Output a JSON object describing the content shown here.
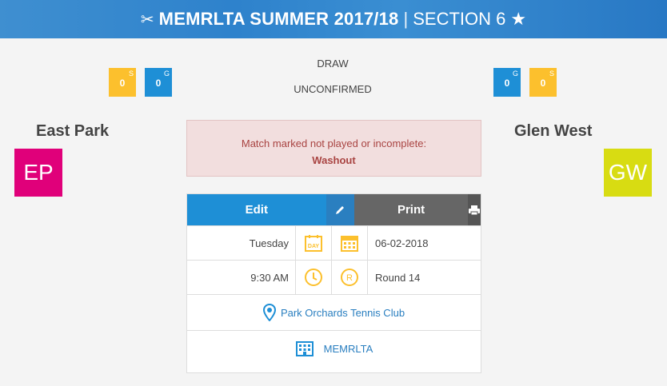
{
  "header": {
    "title": "MEMRLTA SUMMER 2017/18",
    "separator": "|",
    "section": "SECTION 6"
  },
  "result": {
    "outcome": "DRAW",
    "confirmation": "UNCONFIRMED"
  },
  "home": {
    "name": "East Park",
    "abbrev": "EP",
    "color": "#e0007a",
    "sets": "0",
    "sets_label": "S",
    "games": "0",
    "games_label": "G"
  },
  "away": {
    "name": "Glen West",
    "abbrev": "GW",
    "color": "#d8dc12",
    "sets": "0",
    "sets_label": "S",
    "games": "0",
    "games_label": "G"
  },
  "alert": {
    "message": "Match marked not played or incomplete:",
    "reason": "Washout"
  },
  "actions": {
    "edit_label": "Edit",
    "print_label": "Print"
  },
  "details": {
    "day": "Tuesday",
    "day_icon_text": "DAY",
    "date": "06-02-2018",
    "time": "9:30 AM",
    "round_icon_text": "R",
    "round": "Round 14",
    "venue": "Park Orchards Tennis Club",
    "organisation": "MEMRLTA"
  },
  "colors": {
    "blue": "#1e8fd6",
    "yellow": "#fcc02d",
    "alert_bg": "#f2dede",
    "alert_text": "#a94442"
  }
}
